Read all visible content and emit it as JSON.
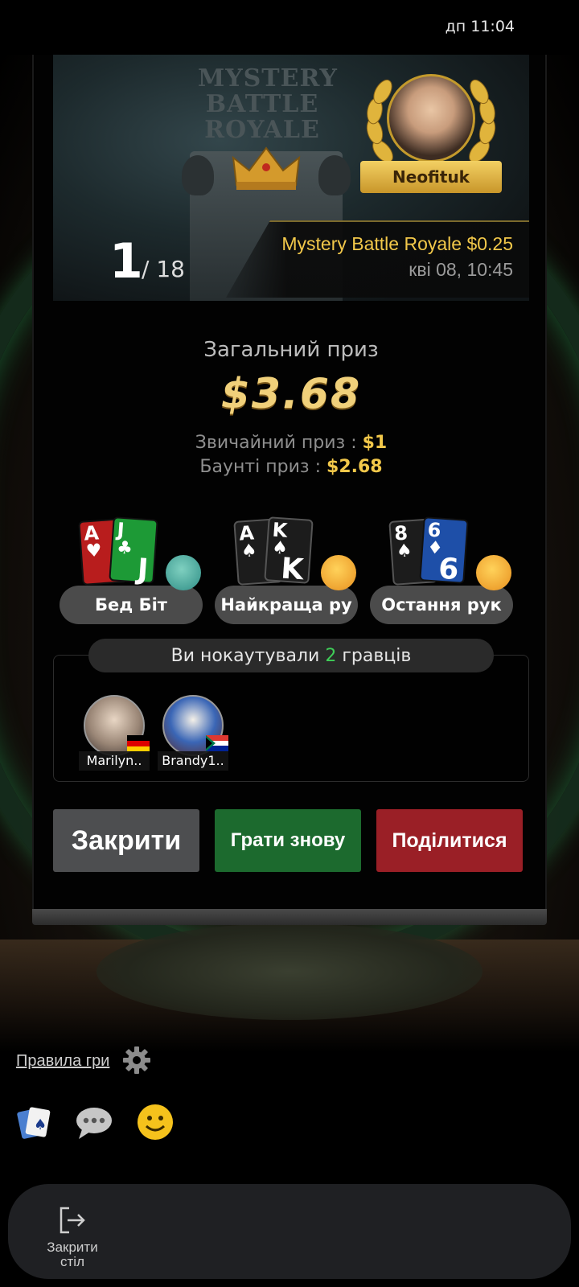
{
  "status_bar": {
    "time": "дп 11:04"
  },
  "banner": {
    "art_title": "MYSTERY BATTLE ROYALE",
    "winner_name": "Neofituk",
    "rank": "1",
    "rank_total": "/ 18",
    "tournament_name": "Mystery Battle Royale $0.25",
    "tournament_date": "кві 08, 10:45"
  },
  "prize": {
    "label": "Загальний приз",
    "total": "$3.68",
    "regular_label": "Звичайний приз :",
    "regular_value": "$1",
    "bounty_label": "Баунті приз :",
    "bounty_value": "$2.68"
  },
  "awards": [
    {
      "label": "Бед Біт",
      "cards": [
        {
          "rank": "A",
          "suit": "♥",
          "color": "#b81d1d"
        },
        {
          "rank": "J",
          "suit": "♣",
          "color": "#1d9a36"
        }
      ],
      "emoji": "cry-laugh"
    },
    {
      "label": "Найкраща ру",
      "cards": [
        {
          "rank": "A",
          "suit": "♠",
          "color": "#1c1c1c"
        },
        {
          "rank": "K",
          "suit": "♠",
          "color": "#1c1c1c"
        }
      ],
      "emoji": "thinking"
    },
    {
      "label": "Остання рук",
      "cards": [
        {
          "rank": "8",
          "suit": "♠",
          "color": "#1c1c1c"
        },
        {
          "rank": "6",
          "suit": "♦",
          "color": "#1e4fa8"
        }
      ],
      "emoji": "facepalm"
    }
  ],
  "knockouts": {
    "text_before": "Ви нокаутували",
    "count": "2",
    "text_after": "гравців",
    "players": [
      {
        "name": "Marilyn..",
        "flag": "germany"
      },
      {
        "name": "Brandy1..",
        "flag": "south-africa"
      }
    ]
  },
  "buttons": {
    "close": "Закрити",
    "play_again": "Грати знову",
    "share": "Поділитися"
  },
  "footer": {
    "rules_link": "Правила гри",
    "exit_label_line1": "Закрити",
    "exit_label_line2": "стіл"
  },
  "colors": {
    "gold": "#f2c84a",
    "play_green": "#1c6a2e",
    "share_red": "#9a1f26",
    "close_gray": "#4d4e50",
    "ko_green": "#3fce58"
  }
}
